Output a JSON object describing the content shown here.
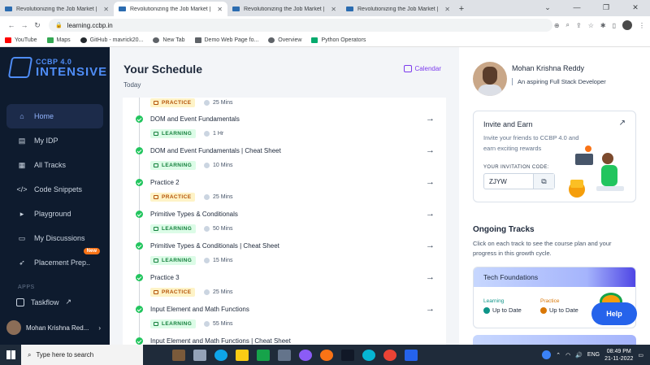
{
  "browser": {
    "tabs": [
      {
        "title": "Revolutionizing the Job Market |",
        "active": false
      },
      {
        "title": "Revolutionizing the Job Market |",
        "active": true
      },
      {
        "title": "Revolutionizing the Job Market |",
        "active": false
      },
      {
        "title": "Revolutionizing the Job Market |",
        "active": false
      }
    ],
    "url": "learning.ccbp.in",
    "bookmarks": [
      {
        "label": "YouTube",
        "color": "#ff0000"
      },
      {
        "label": "Maps",
        "color": "#34a853"
      },
      {
        "label": "GitHub - mavrick20...",
        "color": "#24292e"
      },
      {
        "label": "New Tab",
        "color": "#5f6368"
      },
      {
        "label": "Demo Web Page fo...",
        "color": "#5f6368"
      },
      {
        "label": "Overview",
        "color": "#5f6368"
      },
      {
        "label": "Python Operators",
        "color": "#04aa6d"
      }
    ]
  },
  "sidebar": {
    "logo_top": "CCBP 4.0",
    "logo_bottom": "INTENSIVE",
    "items": [
      {
        "label": "Home",
        "icon": "home-icon",
        "active": true
      },
      {
        "label": "My IDP",
        "icon": "document-icon",
        "active": false
      },
      {
        "label": "All Tracks",
        "icon": "tracks-icon",
        "active": false
      },
      {
        "label": "Code Snippets",
        "icon": "code-icon",
        "active": false
      },
      {
        "label": "Playground",
        "icon": "terminal-icon",
        "active": false
      },
      {
        "label": "My Discussions",
        "icon": "chat-icon",
        "active": false
      },
      {
        "label": "Placement Prep..",
        "icon": "rocket-icon",
        "active": false,
        "badge": "New"
      }
    ],
    "apps_label": "APPS",
    "taskflow": "Taskflow",
    "user": "Mohan Krishna Red..."
  },
  "main": {
    "title": "Your Schedule",
    "subtitle": "Today",
    "calendar": "Calendar",
    "items": [
      {
        "title": "",
        "tag": "PRACTICE",
        "duration": "25 Mins"
      },
      {
        "title": "DOM and Event Fundamentals",
        "tag": "LEARNING",
        "duration": "1 Hr"
      },
      {
        "title": "DOM and Event Fundamentals | Cheat Sheet",
        "tag": "LEARNING",
        "duration": "10 Mins"
      },
      {
        "title": "Practice 2",
        "tag": "PRACTICE",
        "duration": "25 Mins"
      },
      {
        "title": "Primitive Types & Conditionals",
        "tag": "LEARNING",
        "duration": "50 Mins"
      },
      {
        "title": "Primitive Types & Conditionals | Cheat Sheet",
        "tag": "LEARNING",
        "duration": "15 Mins"
      },
      {
        "title": "Practice 3",
        "tag": "PRACTICE",
        "duration": "25 Mins"
      },
      {
        "title": "Input Element and Math Functions",
        "tag": "LEARNING",
        "duration": "55 Mins"
      },
      {
        "title": "Input Element and Math Functions | Cheat Sheet",
        "tag": "",
        "duration": ""
      }
    ]
  },
  "profile": {
    "name": "Mohan Krishna Reddy",
    "description": "An aspiring Full Stack Developer"
  },
  "invite": {
    "title": "Invite and Earn",
    "description": "Invite your friends to CCBP 4.0 and earn exciting rewards",
    "code_label": "YOUR INVITATION CODE:",
    "code": "ZJYW"
  },
  "tracks": {
    "title": "Ongoing Tracks",
    "description": "Click on each track to see the course plan and your progress in this growth cycle.",
    "card_title": "Tech Foundations",
    "learning_label": "Learning",
    "learning_status": "Up to Date",
    "practice_label": "Practice",
    "practice_status": "Up to Date"
  },
  "help": "Help",
  "taskbar": {
    "search_placeholder": "Type here to search",
    "lang": "ENG",
    "time": "08:49 PM",
    "date": "21-11-2022"
  }
}
